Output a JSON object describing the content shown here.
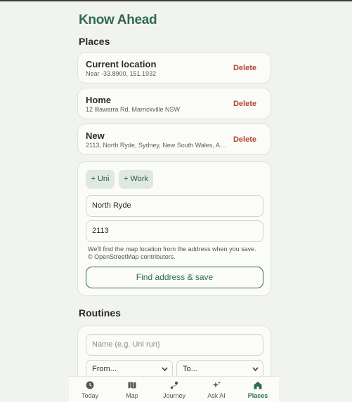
{
  "app": {
    "title": "Know Ahead"
  },
  "places_section": {
    "title": "Places"
  },
  "places": [
    {
      "name": "Current location",
      "address": "Near -33.8900, 151.1932",
      "action": "Delete"
    },
    {
      "name": "Home",
      "address": "12 Illawarra Rd, Marrickville NSW",
      "action": "Delete"
    },
    {
      "name": "New",
      "address": "2113, North Ryde, Sydney, New South Wales, Au...",
      "action": "Delete"
    }
  ],
  "add_place": {
    "chips": [
      "+ Uni",
      "+ Work"
    ],
    "name_value": "North Ryde",
    "postcode_value": "2113",
    "hint_line1": "We'll find the map location from the address when you save.",
    "hint_line2": "© OpenStreetMap contributors.",
    "submit_label": "Find address & save"
  },
  "routines_section": {
    "title": "Routines"
  },
  "routine_form": {
    "name_placeholder": "Name (e.g. Uni run)",
    "from_value": "From...",
    "to_value": "To..."
  },
  "tabbar": {
    "tabs": [
      {
        "label": "Today",
        "icon": "clock-icon"
      },
      {
        "label": "Map",
        "icon": "map-icon"
      },
      {
        "label": "Journey",
        "icon": "route-icon"
      },
      {
        "label": "Ask AI",
        "icon": "sparkle-icon"
      },
      {
        "label": "Places",
        "icon": "home-icon"
      }
    ],
    "active": "Places"
  },
  "colors": {
    "accent": "#2e6b53",
    "danger": "#b04536",
    "background": "#f1f3ee"
  }
}
